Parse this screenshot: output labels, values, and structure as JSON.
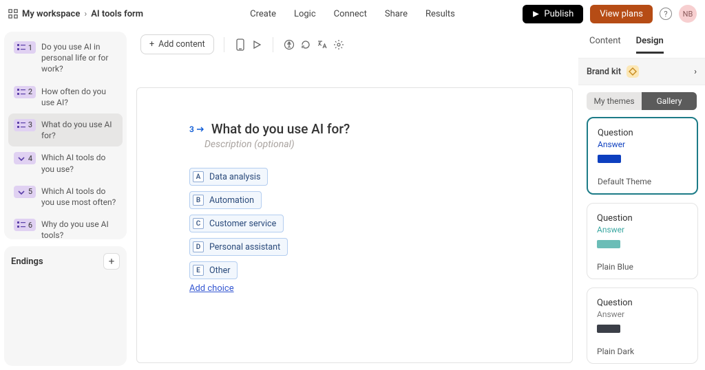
{
  "breadcrumb": {
    "workspace": "My workspace",
    "form": "AI tools form"
  },
  "topnav": {
    "create": "Create",
    "logic": "Logic",
    "connect": "Connect",
    "share": "Share",
    "results": "Results"
  },
  "topright": {
    "publish": "Publish",
    "plans": "View plans",
    "help": "?",
    "avatar": "NB"
  },
  "questions": [
    {
      "num": "1",
      "label": "Do you use AI in personal life or for work?",
      "type": "multi"
    },
    {
      "num": "2",
      "label": "How often do you use AI?",
      "type": "multi"
    },
    {
      "num": "3",
      "label": "What do you use AI for?",
      "type": "multi"
    },
    {
      "num": "4",
      "label": "Which AI tools do you use?",
      "type": "drop"
    },
    {
      "num": "5",
      "label": "Which AI tools do you use most often?",
      "type": "drop"
    },
    {
      "num": "6",
      "label": "Why do you use AI tools?",
      "type": "multi"
    }
  ],
  "endings": {
    "title": "Endings"
  },
  "toolbar": {
    "add_content": "Add content"
  },
  "editor": {
    "index": "3",
    "title": "What do you use AI for?",
    "description_placeholder": "Description (optional)",
    "choices": [
      {
        "key": "A",
        "label": "Data analysis"
      },
      {
        "key": "B",
        "label": "Automation"
      },
      {
        "key": "C",
        "label": "Customer service"
      },
      {
        "key": "D",
        "label": "Personal assistant"
      },
      {
        "key": "E",
        "label": "Other"
      }
    ],
    "add_choice": "Add choice"
  },
  "right": {
    "tabs": {
      "content": "Content",
      "design": "Design"
    },
    "brand_kit": "Brand kit",
    "theme_toggle": {
      "my": "My themes",
      "gallery": "Gallery"
    },
    "themes": [
      {
        "question": "Question",
        "answer": "Answer",
        "answer_color": "#0d3fbf",
        "swatch": "#0d3fbf",
        "name": "Default Theme",
        "selected": true
      },
      {
        "question": "Question",
        "answer": "Answer",
        "answer_color": "#3aa7a1",
        "swatch": "#6bbdb7",
        "name": "Plain Blue",
        "selected": false
      },
      {
        "question": "Question",
        "answer": "Answer",
        "answer_color": "#7a7a7a",
        "swatch": "#3b3f48",
        "name": "Plain Dark",
        "selected": false
      }
    ]
  }
}
